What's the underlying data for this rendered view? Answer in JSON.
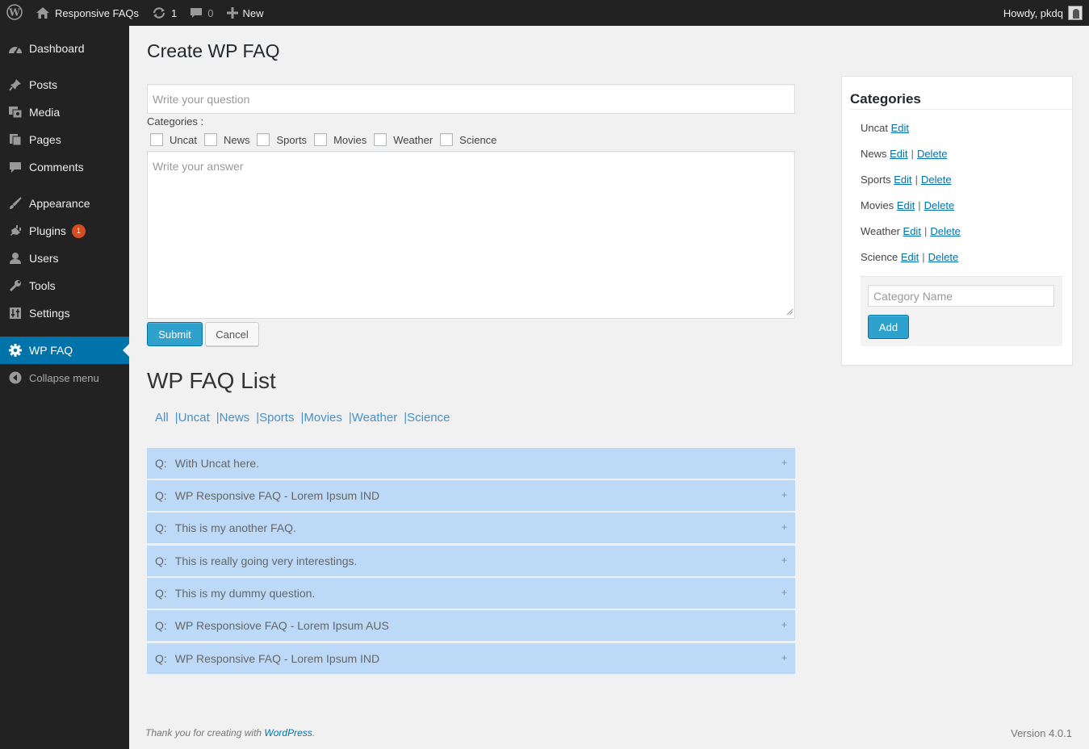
{
  "adminbar": {
    "site_name": "Responsive FAQs",
    "updates_count": "1",
    "comments_count": "0",
    "new_label": "New",
    "howdy": "Howdy, pkdq"
  },
  "sidebar": {
    "items": [
      {
        "label": "Dashboard",
        "icon": "dashboard-icon"
      },
      {
        "label": "Posts",
        "icon": "pin-icon"
      },
      {
        "label": "Media",
        "icon": "media-icon"
      },
      {
        "label": "Pages",
        "icon": "pages-icon"
      },
      {
        "label": "Comments",
        "icon": "comment-icon"
      },
      {
        "label": "Appearance",
        "icon": "brush-icon"
      },
      {
        "label": "Plugins",
        "icon": "plugin-icon",
        "badge": "1"
      },
      {
        "label": "Users",
        "icon": "user-icon"
      },
      {
        "label": "Tools",
        "icon": "wrench-icon"
      },
      {
        "label": "Settings",
        "icon": "settings-icon"
      },
      {
        "label": "WP FAQ",
        "icon": "gear-icon",
        "current": true
      }
    ],
    "collapse_label": "Collapse menu"
  },
  "create": {
    "title": "Create WP FAQ",
    "question_placeholder": "Write your question",
    "categories_label": "Categories :",
    "categories": [
      "Uncat",
      "News",
      "Sports",
      "Movies",
      "Weather",
      "Science"
    ],
    "answer_placeholder": "Write your answer",
    "submit_label": "Submit",
    "cancel_label": "Cancel"
  },
  "list": {
    "title": "WP FAQ List",
    "filters": [
      "All",
      "Uncat",
      "News",
      "Sports",
      "Movies",
      "Weather",
      "Science"
    ],
    "q_prefix": "Q:",
    "faqs": [
      "With Uncat here.",
      "WP Responsive FAQ - Lorem Ipsum IND",
      "This is my another FAQ.",
      "This is really going very interestings.",
      "This is my dummy question.",
      "WP Responsiove FAQ - Lorem Ipsum AUS",
      "WP Responsive FAQ - Lorem Ipsum IND"
    ]
  },
  "category_box": {
    "title": "Categories",
    "edit_label": "Edit",
    "delete_label": "Delete",
    "rows": [
      {
        "name": "Uncat",
        "deletable": false
      },
      {
        "name": "News",
        "deletable": true
      },
      {
        "name": "Sports",
        "deletable": true
      },
      {
        "name": "Movies",
        "deletable": true
      },
      {
        "name": "Weather",
        "deletable": true
      },
      {
        "name": "Science",
        "deletable": true
      }
    ],
    "name_placeholder": "Category Name",
    "add_label": "Add"
  },
  "footer": {
    "thanks_prefix": "Thank you for creating with ",
    "wordpress": "WordPress",
    "thanks_suffix": ".",
    "version": "Version 4.0.1"
  },
  "colors": {
    "admin_bg": "#222222",
    "accent": "#0073aa",
    "primary_button": "#2ea2cc",
    "faq_row": "#bcdaf7",
    "badge": "#d54e21"
  }
}
